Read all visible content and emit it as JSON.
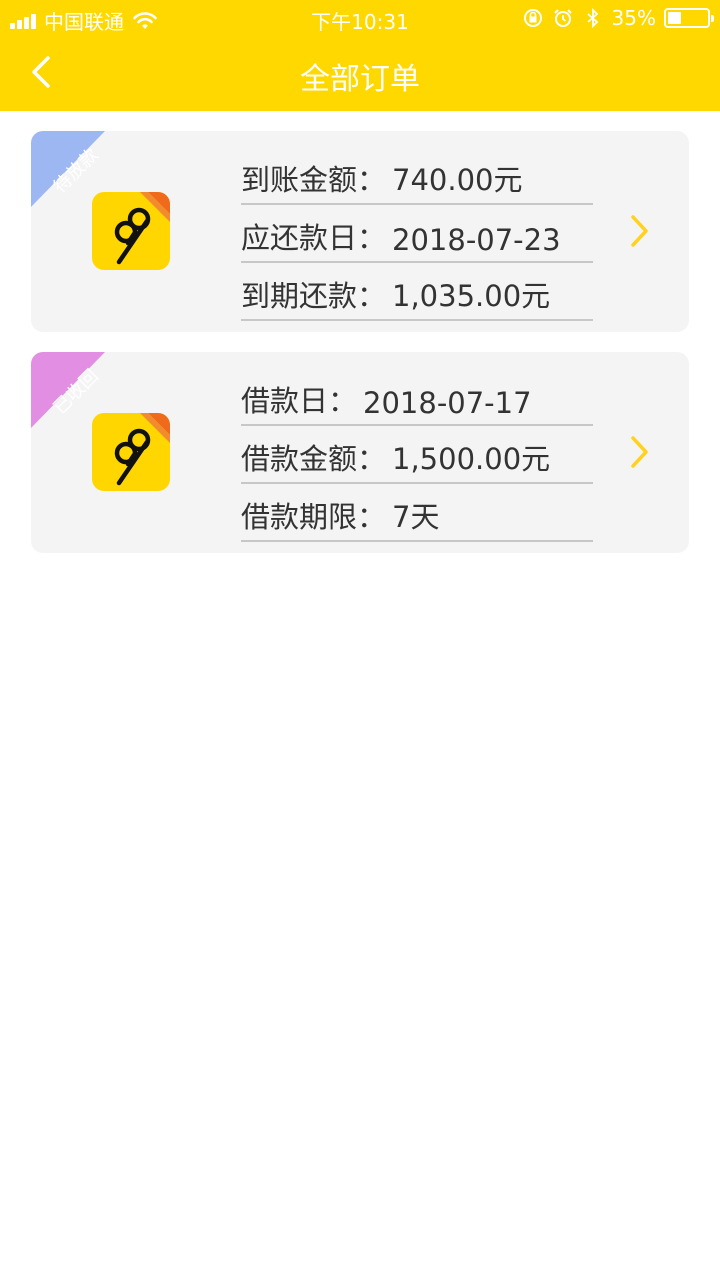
{
  "status_bar": {
    "carrier": "中国联通",
    "time": "下午10:31",
    "battery": "35%",
    "battery_level": 0.35
  },
  "nav": {
    "title": "全部订单",
    "back_icon": "chevron-left-icon"
  },
  "colors": {
    "header": "#FFD800",
    "card_bg": "#F4F4F4",
    "chevron": "#FFD21F",
    "ribbon_pending": "#9DB7F3",
    "ribbon_recovered": "#E28EE2"
  },
  "orders": [
    {
      "status": "待放款",
      "status_color": "#9DB7F3",
      "app_icon": "app-99-icon",
      "rows": [
        {
          "label": "到账金额：",
          "value": "740.00元"
        },
        {
          "label": "应还款日：",
          "value": "2018-07-23"
        },
        {
          "label": "到期还款：",
          "value": "1,035.00元"
        }
      ]
    },
    {
      "status": "已收回",
      "status_color": "#E28EE2",
      "app_icon": "app-99-icon",
      "rows": [
        {
          "label": "借款日：",
          "value": "2018-07-17"
        },
        {
          "label": "借款金额：",
          "value": "1,500.00元"
        },
        {
          "label": "借款期限：",
          "value": "7天"
        }
      ]
    }
  ]
}
